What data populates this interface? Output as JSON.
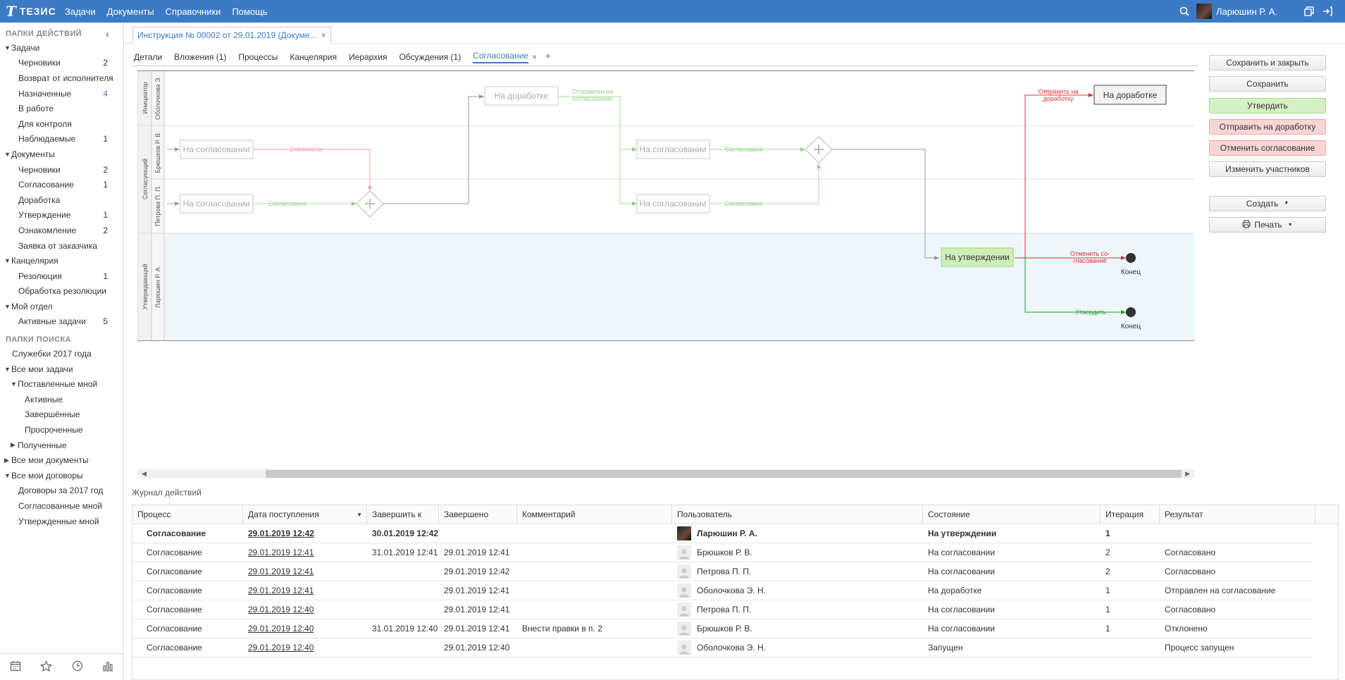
{
  "topbar": {
    "logo_text": "ТЕЗИС",
    "nav": [
      "Задачи",
      "Документы",
      "Справочники",
      "Помощь"
    ],
    "user_name": "Ларюшин Р. А."
  },
  "sidebar": {
    "actions_header": "ПАПКИ ДЕЙСТВИЙ",
    "action_items": [
      {
        "label": "Задачи",
        "level": 0,
        "arrow": "down",
        "count": ""
      },
      {
        "label": "Черновики",
        "level": 2,
        "arrow": "",
        "count": "2"
      },
      {
        "label": "Возврат от исполнителя",
        "level": 2,
        "arrow": "",
        "count": ""
      },
      {
        "label": "Назначенные",
        "level": 2,
        "arrow": "",
        "count": "4",
        "highlight": true
      },
      {
        "label": "В работе",
        "level": 2,
        "arrow": "",
        "count": ""
      },
      {
        "label": "Для контроля",
        "level": 2,
        "arrow": "",
        "count": ""
      },
      {
        "label": "Наблюдаемые",
        "level": 2,
        "arrow": "",
        "count": "1"
      },
      {
        "label": "Документы",
        "level": 0,
        "arrow": "down",
        "count": ""
      },
      {
        "label": "Черновики",
        "level": 2,
        "arrow": "",
        "count": "2"
      },
      {
        "label": "Согласование",
        "level": 2,
        "arrow": "",
        "count": "1"
      },
      {
        "label": "Доработка",
        "level": 2,
        "arrow": "",
        "count": ""
      },
      {
        "label": "Утверждение",
        "level": 2,
        "arrow": "",
        "count": "1"
      },
      {
        "label": "Ознакомление",
        "level": 2,
        "arrow": "",
        "count": "2"
      },
      {
        "label": "Заявка от заказчика",
        "level": 2,
        "arrow": "",
        "count": ""
      },
      {
        "label": "Канцелярия",
        "level": 0,
        "arrow": "down",
        "count": ""
      },
      {
        "label": "Резолюция",
        "level": 2,
        "arrow": "",
        "count": "1"
      },
      {
        "label": "Обработка резолюции",
        "level": 2,
        "arrow": "",
        "count": ""
      },
      {
        "label": "Мой отдел",
        "level": 0,
        "arrow": "down",
        "count": ""
      },
      {
        "label": "Активные задачи",
        "level": 2,
        "arrow": "",
        "count": "5"
      }
    ],
    "search_header": "ПАПКИ ПОИСКА",
    "search_items": [
      {
        "label": "Служебки 2017 года",
        "level": 1,
        "arrow": ""
      },
      {
        "label": "Все мои задачи",
        "level": 0,
        "arrow": "down"
      },
      {
        "label": "Поставленные мной",
        "level": 1,
        "arrow": "down"
      },
      {
        "label": "Активные",
        "level": 3,
        "arrow": ""
      },
      {
        "label": "Завершённые",
        "level": 3,
        "arrow": ""
      },
      {
        "label": "Просроченные",
        "level": 3,
        "arrow": ""
      },
      {
        "label": "Полученные",
        "level": 1,
        "arrow": "right"
      },
      {
        "label": "Все мои документы",
        "level": 0,
        "arrow": "right"
      },
      {
        "label": "Все мои договоры",
        "level": 0,
        "arrow": "down"
      },
      {
        "label": "Договоры за 2017 год",
        "level": 2,
        "arrow": ""
      },
      {
        "label": "Согласованные мной",
        "level": 2,
        "arrow": ""
      },
      {
        "label": "Утвержденные мной",
        "level": 2,
        "arrow": ""
      }
    ]
  },
  "doc_tab": {
    "title": "Инструкция № 00002 от 29.01.2019 (Докуме..."
  },
  "subtabs": [
    {
      "label": "Детали",
      "active": false
    },
    {
      "label": "Вложения (1)",
      "active": false
    },
    {
      "label": "Процессы",
      "active": false
    },
    {
      "label": "Канцелярия",
      "active": false
    },
    {
      "label": "Иерархия",
      "active": false
    },
    {
      "label": "Обсуждения (1)",
      "active": false
    },
    {
      "label": "Согласование",
      "active": true
    }
  ],
  "buttons": [
    {
      "label": "Сохранить и закрыть",
      "style": "default"
    },
    {
      "label": "Сохранить",
      "style": "default"
    },
    {
      "label": "Утвердить",
      "style": "green"
    },
    {
      "label": "Отправить на доработку",
      "style": "red"
    },
    {
      "label": "Отменить согласование",
      "style": "red"
    },
    {
      "label": "Изменить участников",
      "style": "default"
    }
  ],
  "buttons2": [
    {
      "label": "Создать",
      "icon": ""
    },
    {
      "label": "Печать",
      "icon": "printer"
    }
  ],
  "diagram": {
    "pools": {
      "initiator": "Инициатор",
      "approvers": "Согласующий",
      "approver_final": "Утверждающий"
    },
    "lanes": {
      "l1": "Оболочкова Э.",
      "l2": "Брюшков Р. В.",
      "l3": "Петрова П. П.",
      "l4": "Ларюшин Р. А."
    },
    "tasks": {
      "t_rework1": "На доработке",
      "t_agree_b1": "На согласовании",
      "t_agree_p1": "На согласовании",
      "t_agree_b2": "На согласовании",
      "t_agree_p2": "На согласовании",
      "t_approve": "На утверждении",
      "t_rework2": "На доработке"
    },
    "flows": {
      "f_rejected": "Отклонено",
      "f_agreed1": "Согласовано",
      "f_sent1": "Отправлен на",
      "f_sent2": "согласование",
      "f_agreed2": "Согласовано",
      "f_agreed3": "Согласовано",
      "f_send_rework1": "Отправить на",
      "f_send_rework2": "доработку",
      "f_cancel1": "Отменить со-",
      "f_cancel2": "гласование",
      "f_approve": "Утвердить"
    },
    "ends": {
      "e1": "Конец",
      "e2": "Конец"
    }
  },
  "log": {
    "title": "Журнал действий",
    "columns": [
      "Процесс",
      "Дата поступления",
      "Завершить к",
      "Завершено",
      "Комментарий",
      "Пользователь",
      "Состояние",
      "Итерация",
      "Результат"
    ],
    "rows": [
      {
        "process": "Согласование",
        "date": "29.01.2019 12:42",
        "due": "30.01.2019 12:42",
        "done": "",
        "comment": "",
        "user": "Ларюшин Р. А.",
        "avatar": "photo",
        "state": "На утверждении",
        "iter": "1",
        "result": "",
        "bold": true
      },
      {
        "process": "Согласование",
        "date": "29.01.2019 12:41",
        "due": "31.01.2019 12:41",
        "done": "29.01.2019 12:41",
        "comment": "",
        "user": "Брюшков Р. В.",
        "avatar": "generic",
        "state": "На согласовании",
        "iter": "2",
        "result": "Согласовано",
        "bold": false
      },
      {
        "process": "Согласование",
        "date": "29.01.2019 12:41",
        "due": "",
        "done": "29.01.2019 12:42",
        "comment": "",
        "user": "Петрова П. П.",
        "avatar": "generic",
        "state": "На согласовании",
        "iter": "2",
        "result": "Согласовано",
        "bold": false
      },
      {
        "process": "Согласование",
        "date": "29.01.2019 12:41",
        "due": "",
        "done": "29.01.2019 12:41",
        "comment": "",
        "user": "Оболочкова Э. Н.",
        "avatar": "generic",
        "state": "На доработке",
        "iter": "1",
        "result": "Отправлен на согласование",
        "bold": false
      },
      {
        "process": "Согласование",
        "date": "29.01.2019 12:40",
        "due": "",
        "done": "29.01.2019 12:41",
        "comment": "",
        "user": "Петрова П. П.",
        "avatar": "generic",
        "state": "На согласовании",
        "iter": "1",
        "result": "Согласовано",
        "bold": false
      },
      {
        "process": "Согласование",
        "date": "29.01.2019 12:40",
        "due": "31.01.2019 12:40",
        "done": "29.01.2019 12:41",
        "comment": "Внести правки в п. 2",
        "user": "Брюшков Р. В.",
        "avatar": "generic",
        "state": "На согласовании",
        "iter": "1",
        "result": "Отклонено",
        "bold": false
      },
      {
        "process": "Согласование",
        "date": "29.01.2019 12:40",
        "due": "",
        "done": "29.01.2019 12:40",
        "comment": "",
        "user": "Оболочкова Э. Н.",
        "avatar": "generic",
        "state": "Запущен",
        "iter": "",
        "result": "Процесс запущен",
        "bold": false
      }
    ]
  },
  "colors": {
    "brand": "#3d7ac6",
    "agreed": "#7ccb6e",
    "rejected": "#e06060",
    "approve_task": "#cfefb8"
  }
}
